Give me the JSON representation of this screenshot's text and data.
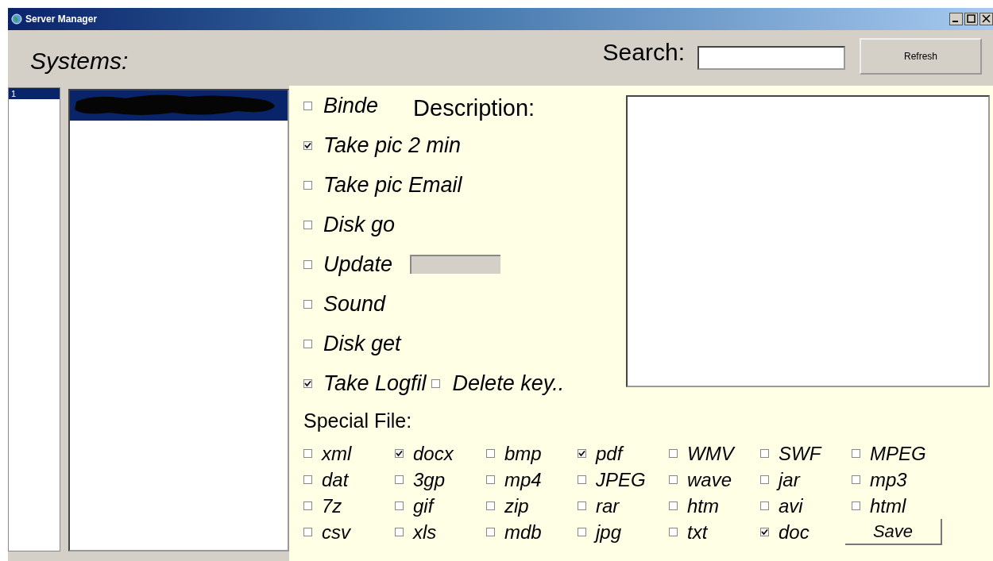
{
  "window": {
    "title": "Server Manager"
  },
  "toolbar": {
    "heading": "Systems:",
    "search_label": "Search:",
    "refresh_button": "Refresh"
  },
  "systems_list": [
    {
      "label": "1",
      "selected": true
    }
  ],
  "hosts_list": [
    {
      "kind": "redacted",
      "selected": true
    }
  ],
  "options": [
    {
      "label": "Binde",
      "checked": false,
      "kind": "check"
    },
    {
      "label": "Take pic 2 min",
      "checked": true,
      "kind": "check"
    },
    {
      "label": "Take pic Email",
      "checked": false,
      "kind": "check"
    },
    {
      "label": "Disk go",
      "checked": false,
      "kind": "check"
    },
    {
      "label": "Update",
      "checked": false,
      "kind": "progress"
    },
    {
      "label": "Sound",
      "checked": false,
      "kind": "check"
    },
    {
      "label": "Disk get",
      "checked": false,
      "kind": "check"
    }
  ],
  "option_pair": [
    {
      "label": "Take Logfil",
      "checked": true
    },
    {
      "label": "Delete key..",
      "checked": false
    }
  ],
  "description": {
    "label": "Description:"
  },
  "special_file": {
    "label": "Special File:",
    "rows": [
      [
        {
          "label": "xml",
          "checked": false
        },
        {
          "label": "docx",
          "checked": true
        },
        {
          "label": "bmp",
          "checked": false
        },
        {
          "label": "pdf",
          "checked": true
        },
        {
          "label": "WMV",
          "checked": false
        },
        {
          "label": "SWF",
          "checked": false
        },
        {
          "label": "MPEG",
          "checked": false
        }
      ],
      [
        {
          "label": "dat",
          "checked": false
        },
        {
          "label": "3gp",
          "checked": false
        },
        {
          "label": "mp4",
          "checked": false
        },
        {
          "label": "JPEG",
          "checked": false
        },
        {
          "label": "wave",
          "checked": false
        },
        {
          "label": "jar",
          "checked": false
        },
        {
          "label": "mp3",
          "checked": false
        }
      ],
      [
        {
          "label": "7z",
          "checked": false
        },
        {
          "label": "gif",
          "checked": false
        },
        {
          "label": "zip",
          "checked": false
        },
        {
          "label": "rar",
          "checked": false
        },
        {
          "label": "htm",
          "checked": false
        },
        {
          "label": "avi",
          "checked": false
        },
        {
          "label": "html",
          "checked": false
        }
      ],
      [
        {
          "label": "csv",
          "checked": false
        },
        {
          "label": "xls",
          "checked": false
        },
        {
          "label": "mdb",
          "checked": false
        },
        {
          "label": "jpg",
          "checked": false
        },
        {
          "label": "txt",
          "checked": false
        },
        {
          "label": "doc",
          "checked": true
        }
      ]
    ]
  },
  "save_button": "Save"
}
